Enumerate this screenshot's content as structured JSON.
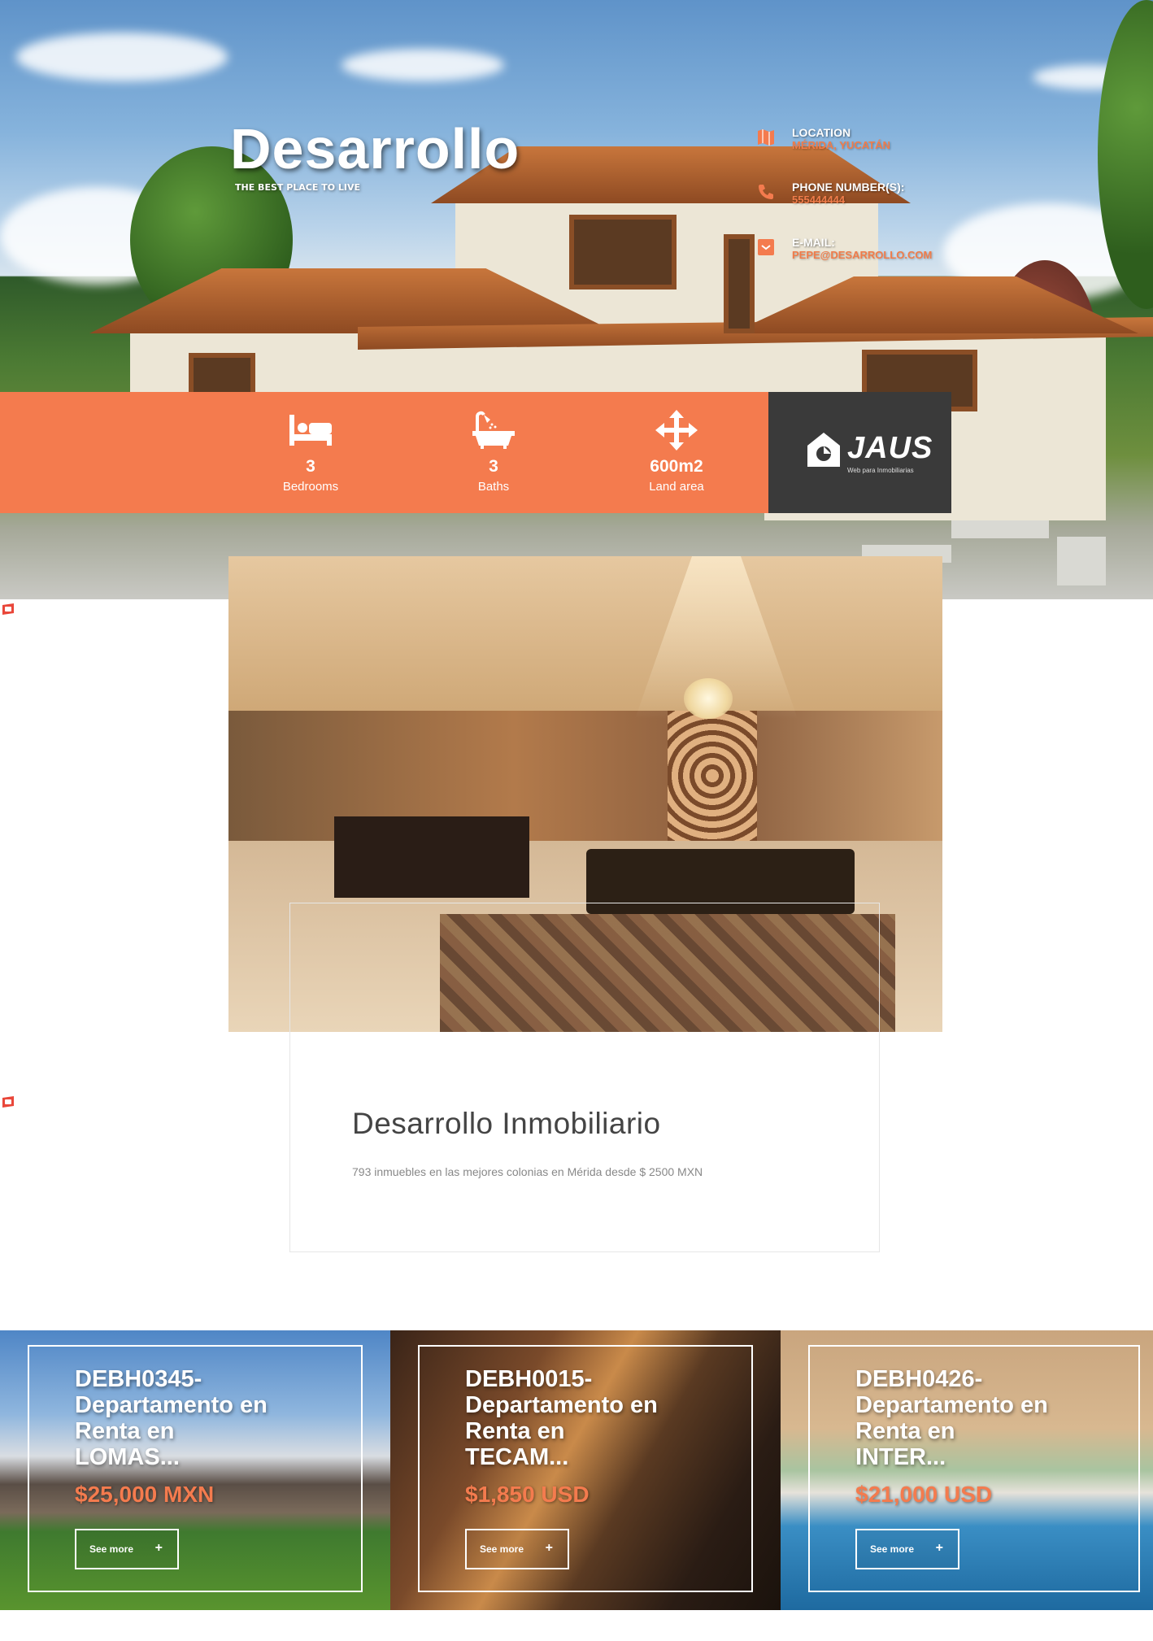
{
  "brand": {
    "title": "Desarrollo",
    "subtitle": "THE BEST PLACE TO LIVE"
  },
  "contact": {
    "location_label": "LOCATION",
    "location_value": "MÉRIDA, YUCATÁN",
    "phone_label": "PHONE NUMBER(S):",
    "phone_value": "555444444",
    "email_label": "E-MAIL:",
    "email_value": "PEPE@DESARROLLO.COM"
  },
  "features": [
    {
      "icon": "bed-icon",
      "value": "3",
      "label": "Bedrooms"
    },
    {
      "icon": "bathtub-icon",
      "value": "3",
      "label": "Baths"
    },
    {
      "icon": "arrows-move-icon",
      "value": "600m2",
      "label": "Land area"
    }
  ],
  "logo": {
    "word": "JAUS",
    "tagline": "Web para Inmobiliarias"
  },
  "info": {
    "title": "Desarrollo Inmobiliario",
    "description": "793 inmuebles en las mejores colonias en Mérida desde $ 2500 MXN"
  },
  "listings": [
    {
      "title": "DEBH0345-Departamento en Renta en LOMAS...",
      "price": "$25,000 MXN",
      "button": "See more",
      "plus": "+"
    },
    {
      "title": "DEBH0015-Departamento en Renta en TECAM...",
      "price": "$1,850 USD",
      "button": "See more",
      "plus": "+"
    },
    {
      "title": "DEBH0426-Departamento en Renta en INTER...",
      "price": "$21,000 USD",
      "button": "See more",
      "plus": "+"
    }
  ],
  "colors": {
    "accent": "#f47b4e",
    "dark": "#3a3a3a"
  }
}
